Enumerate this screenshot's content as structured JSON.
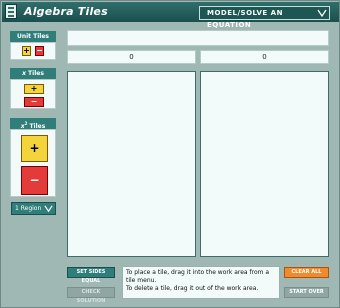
{
  "window": {
    "title": "Algebra Tiles",
    "mode_label": "MODEL/SOLVE AN EQUATION"
  },
  "palette": {
    "unit_tiles": {
      "label": "Unit Tiles",
      "plus": "+",
      "minus": "−"
    },
    "x_tiles": {
      "label": "x",
      "label_suffix": " Tiles",
      "plus": "+",
      "minus": "−"
    },
    "x2_tiles": {
      "label": "x",
      "superscript": "2",
      "label_suffix": " Tiles",
      "plus": "+",
      "minus": "−"
    },
    "region_select": "1 Region"
  },
  "workspace": {
    "left_value": "0",
    "right_value": "0"
  },
  "controls": {
    "set_sides_equal": "SET SIDES EQUAL",
    "check_solution": "CHECK SOLUTION",
    "clear_all": "CLEAR ALL",
    "start_over": "START OVER"
  },
  "instructions": {
    "line1": "To place a tile, drag it into the work area from a tile menu.",
    "line2": "To delete a tile, drag it out of the work area."
  },
  "colors": {
    "accent": "#2f7e79",
    "title_bar": "#1b4f4d",
    "plus_tile": "#f3d43a",
    "minus_tile": "#e33a3a",
    "clear_button": "#f08a2c"
  }
}
